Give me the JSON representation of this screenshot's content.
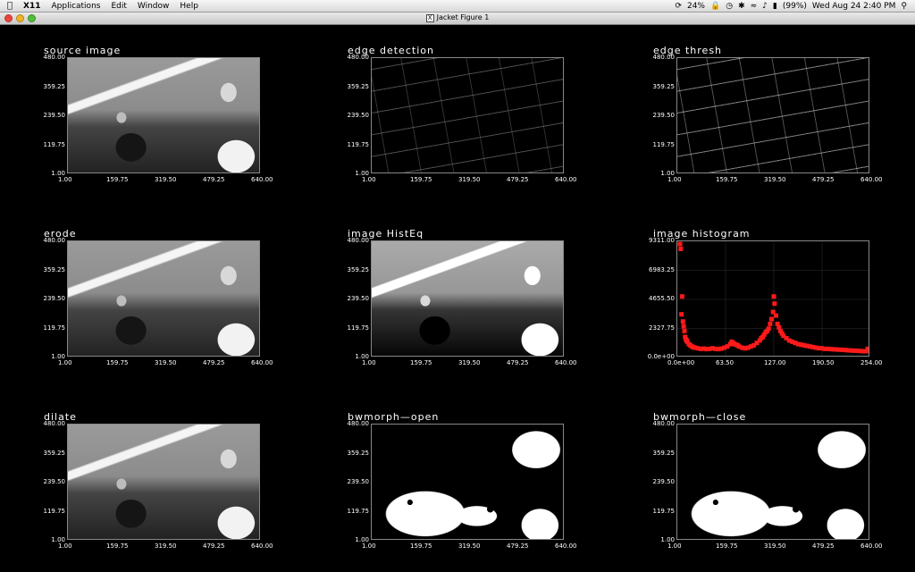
{
  "menubar": {
    "apple": "",
    "app": "X11",
    "items": [
      "Applications",
      "Edit",
      "Window",
      "Help"
    ],
    "battery_pct_small": "24%",
    "battery": "(99%)",
    "clock": "Wed Aug 24  2:40 PM"
  },
  "window": {
    "title": "Jacket Figure 1"
  },
  "panels": [
    {
      "title": "source  image",
      "kind": "photo"
    },
    {
      "title": "edge  detection",
      "kind": "edges"
    },
    {
      "title": "edge  thresh",
      "kind": "thresh"
    },
    {
      "title": "erode",
      "kind": "photo"
    },
    {
      "title": "image  HistEq",
      "kind": "eq"
    },
    {
      "title": "image  histogram",
      "kind": "hist"
    },
    {
      "title": "dilate",
      "kind": "photo"
    },
    {
      "title": "bwmorph—open",
      "kind": "bw"
    },
    {
      "title": "bwmorph—close",
      "kind": "bw"
    }
  ],
  "image_axes": {
    "yticks": [
      "480.00",
      "359.25",
      "239.50",
      "119.75",
      "1.00"
    ],
    "xticks": [
      "1.00",
      "159.75",
      "319.50",
      "479.25",
      "640.00"
    ]
  },
  "chart_data": {
    "type": "scatter",
    "title": "image  histogram",
    "xlim": [
      0,
      254
    ],
    "ylim": [
      0,
      9311
    ],
    "xticks": [
      "0.0e+00",
      "63.50",
      "127.00",
      "190.50",
      "254.00"
    ],
    "yticks": [
      "9311.00",
      "6983.25",
      "4655.50",
      "2327.75",
      "0.0e+00"
    ],
    "marker_color": "#ff1a1a",
    "series": [
      {
        "x": [
          0,
          1,
          2,
          3,
          4,
          5,
          6,
          7,
          8,
          9,
          10,
          12,
          14,
          16,
          18,
          20,
          24,
          28,
          32,
          36,
          40,
          44,
          48,
          52,
          56,
          60,
          64,
          68,
          70,
          72,
          74,
          76,
          78,
          80,
          84,
          88,
          92,
          96,
          100,
          104,
          108,
          110,
          112,
          114,
          116,
          118,
          120,
          122,
          124,
          126,
          127,
          128,
          130,
          132,
          134,
          136,
          138,
          140,
          144,
          148,
          152,
          156,
          160,
          164,
          168,
          172,
          176,
          180,
          184,
          188,
          192,
          196,
          200,
          204,
          208,
          212,
          216,
          220,
          224,
          228,
          232,
          236,
          240,
          244,
          248,
          252,
          254
        ],
        "y": [
          9311,
          8900,
          3400,
          4900,
          2800,
          2400,
          2000,
          1500,
          1300,
          1200,
          1100,
          900,
          800,
          700,
          650,
          600,
          550,
          500,
          520,
          480,
          500,
          550,
          500,
          480,
          520,
          600,
          700,
          900,
          1100,
          1000,
          900,
          850,
          800,
          700,
          600,
          550,
          600,
          700,
          800,
          1000,
          1200,
          1400,
          1500,
          1700,
          1900,
          2000,
          2200,
          2600,
          3000,
          3600,
          4900,
          4300,
          3300,
          2600,
          2300,
          2000,
          1800,
          1600,
          1400,
          1200,
          1100,
          1000,
          900,
          850,
          800,
          750,
          700,
          650,
          600,
          550,
          550,
          500,
          500,
          480,
          460,
          450,
          430,
          420,
          400,
          380,
          360,
          350,
          340,
          320,
          300,
          300,
          500
        ]
      }
    ]
  }
}
